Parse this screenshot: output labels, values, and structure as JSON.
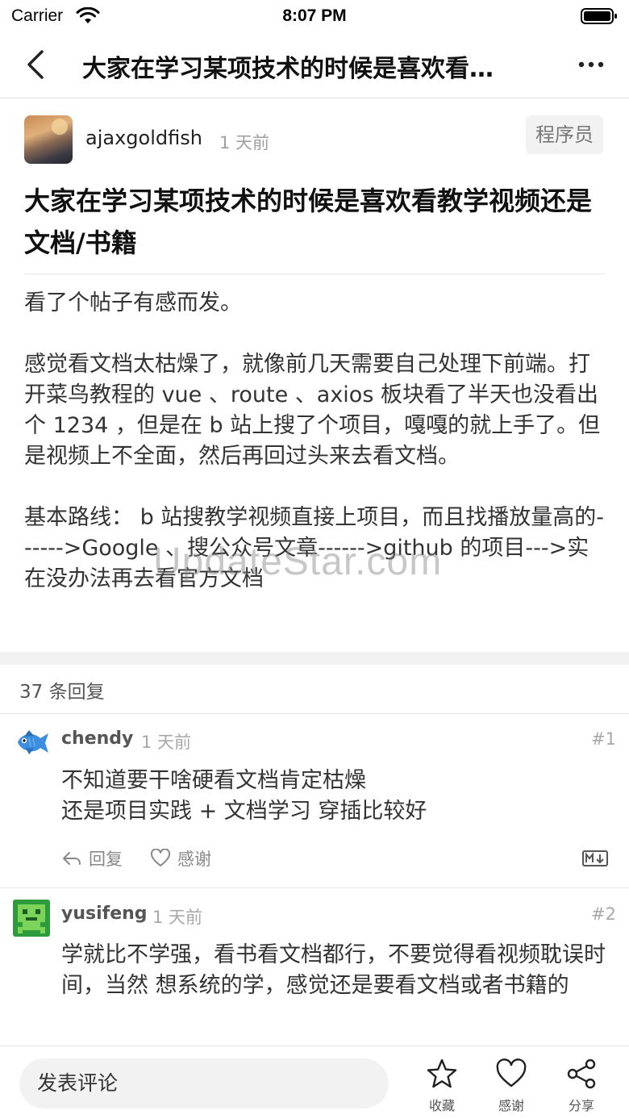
{
  "status_bar": {
    "carrier": "Carrier",
    "time": "8:07 PM"
  },
  "nav": {
    "title": "大家在学习某项技术的时候是喜欢看…"
  },
  "post": {
    "author": "ajaxgoldfish",
    "time": "1 天前",
    "node": "程序员",
    "title": "大家在学习某项技术的时候是喜欢看教学视频还是文档/书籍",
    "paragraphs": [
      "看了个帖子有感而发。",
      "感觉看文档太枯燥了，就像前几天需要自己处理下前端。打开菜鸟教程的 vue 、route 、axios 板块看了半天也没看出个 1234 ，但是在 b 站上搜了个项目，嘎嘎的就上手了。但是视频上不全面，然后再回过头来去看文档。",
      "基本路线： b 站搜教学视频直接上项目，而且找播放量高的------>Google 、搜公众号文章------>github 的项目--->实在没办法再去看官方文档"
    ],
    "watermark": "UpdateStar.com"
  },
  "replies_header": "37 条回复",
  "replies": [
    {
      "author": "chendy",
      "time": "1 天前",
      "floor": "#1",
      "lines": [
        "不知道要干啥硬看文档肯定枯燥",
        "还是项目实践 + 文档学习 穿插比较好"
      ],
      "reply_label": "回复",
      "thanks_label": "感谢"
    },
    {
      "author": "yusifeng",
      "time": "1 天前",
      "floor": "#2",
      "lines": [
        "学就比不学强，看书看文档都行，不要觉得看视频耽误时间，当然 想系统的学，感觉还是要看文档或者书籍的"
      ]
    }
  ],
  "bottom_bar": {
    "comment_placeholder": "发表评论",
    "favorite_label": "收藏",
    "thanks_label": "感谢",
    "share_label": "分享"
  },
  "colors": {
    "accent": "#111111",
    "muted": "#a0a0a0",
    "gap": "#f2f2f2"
  }
}
